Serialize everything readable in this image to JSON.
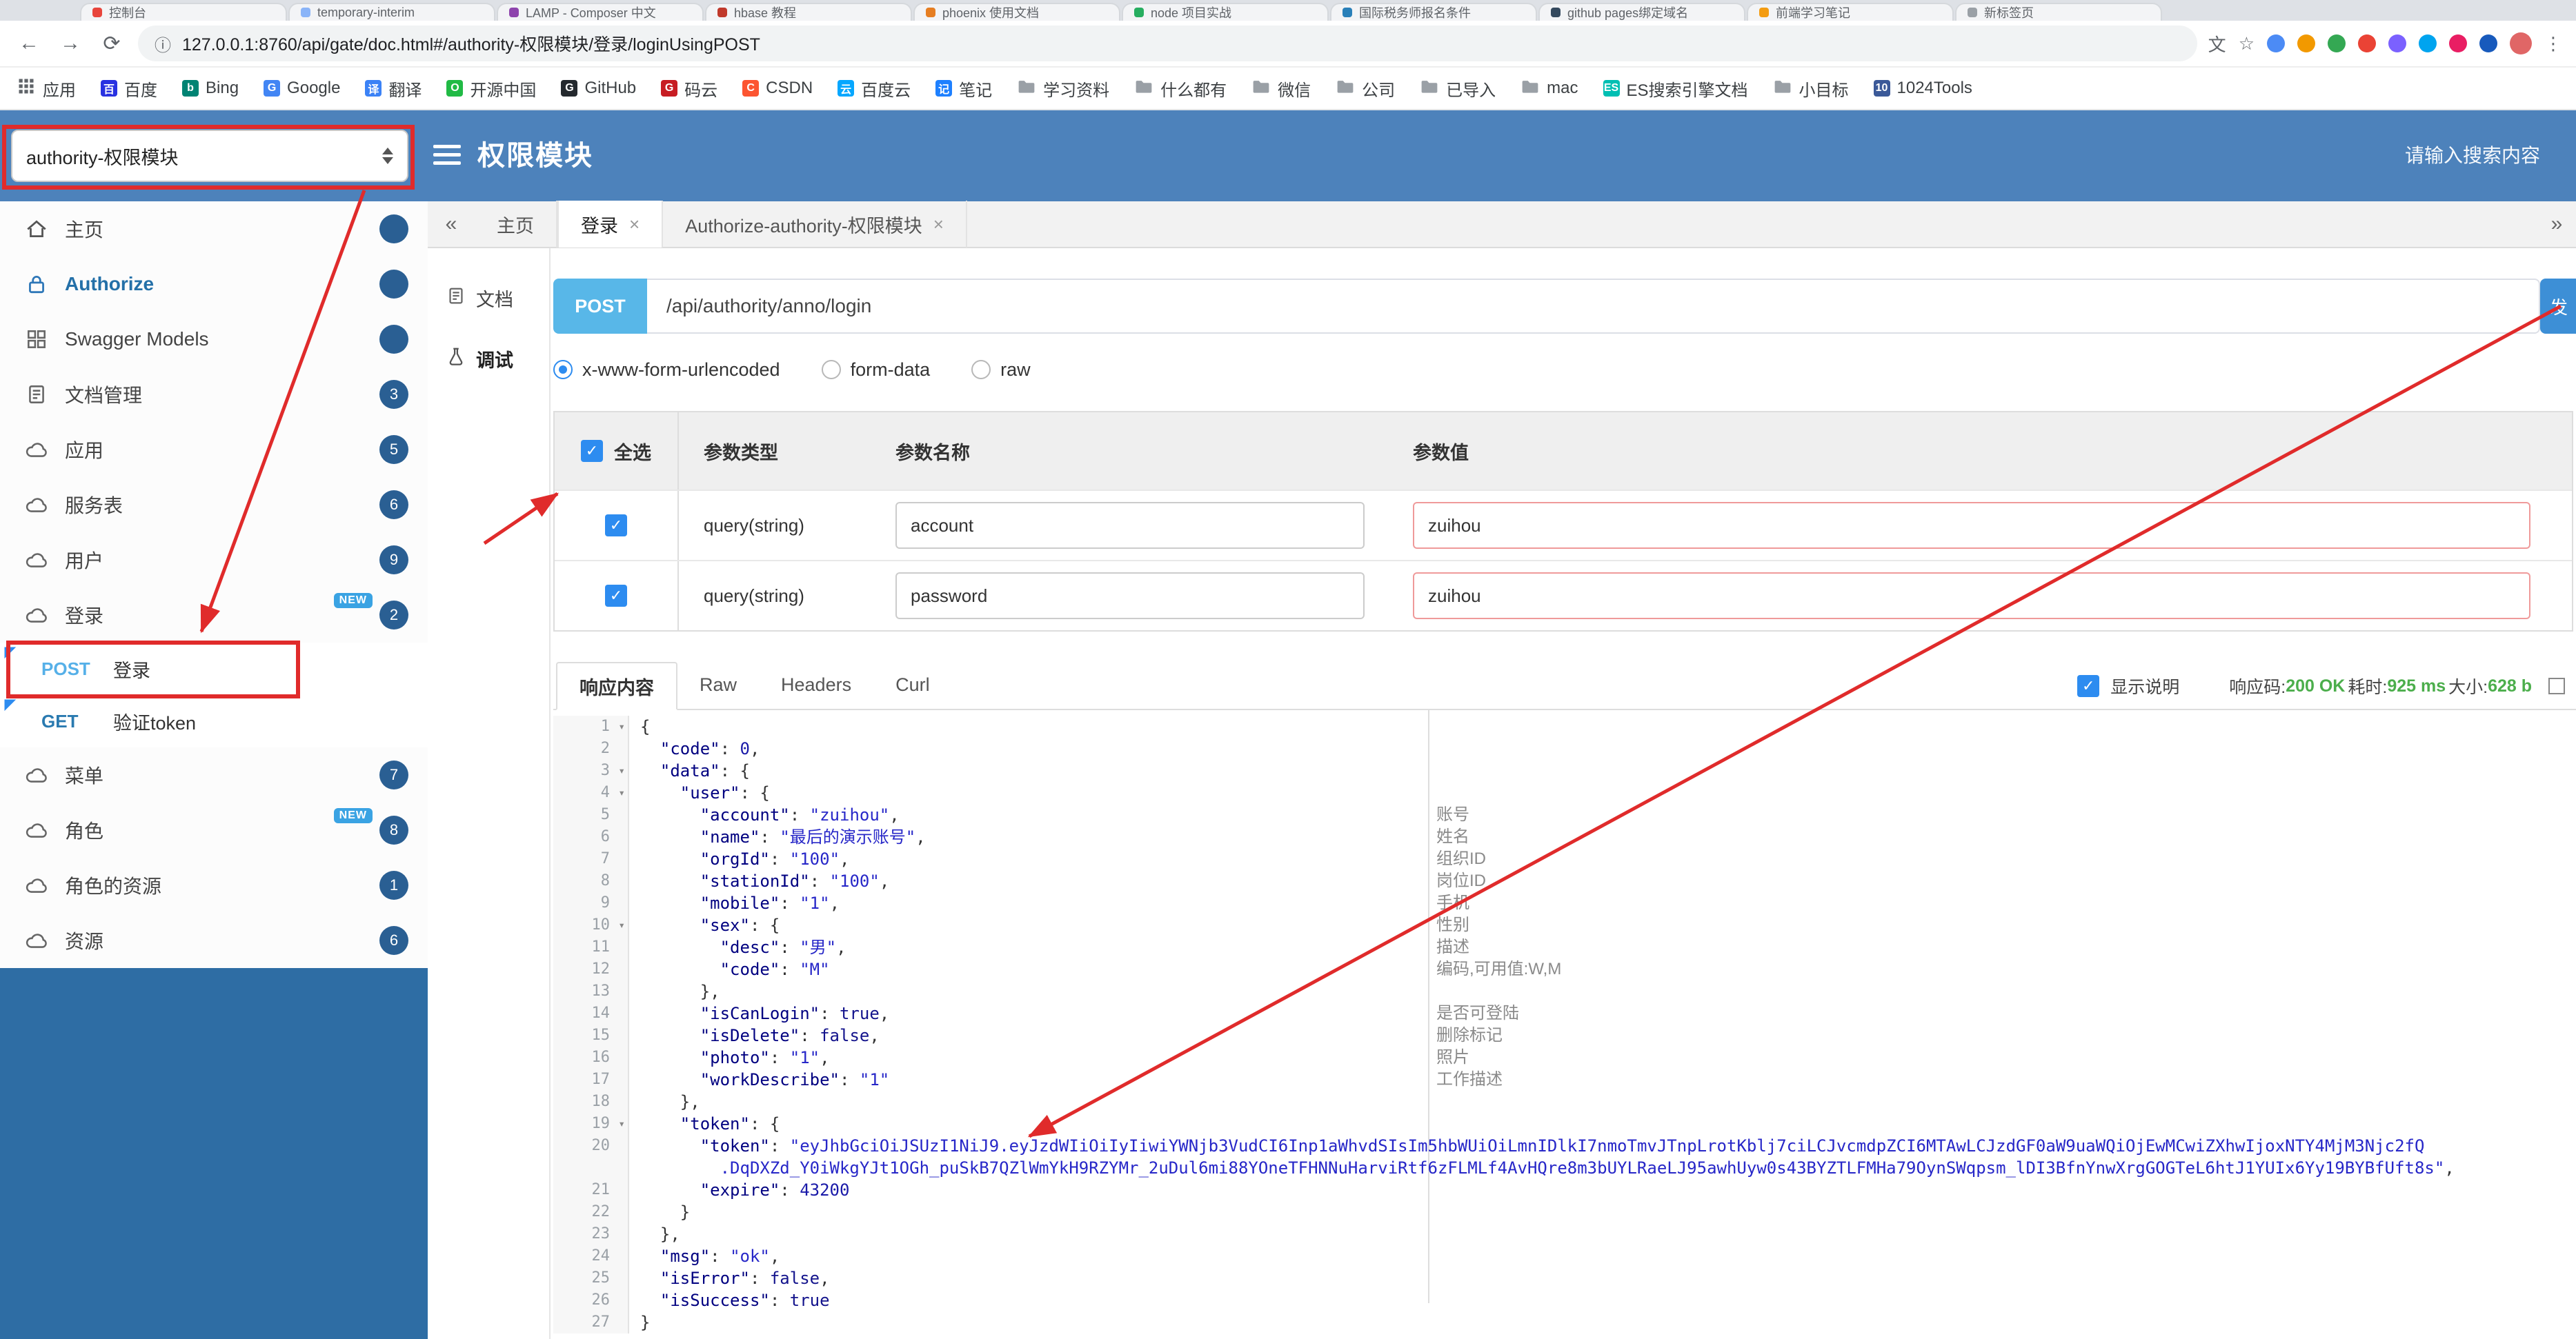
{
  "browser": {
    "window_lights": [
      "#ff5f57",
      "#febc2e",
      "#28c840"
    ],
    "tabs": [
      {
        "title": "控制台",
        "color": "#e8453c"
      },
      {
        "title": "temporary-interim",
        "color": "#8ab4f8"
      },
      {
        "title": "LAMP - Composer 中文",
        "color": "#8e44ad"
      },
      {
        "title": "hbase 教程",
        "color": "#c0392b"
      },
      {
        "title": "phoenix 使用文档",
        "color": "#e67e22"
      },
      {
        "title": "node 项目实战",
        "color": "#27ae60"
      },
      {
        "title": "国际税务师报名条件",
        "color": "#2980b9"
      },
      {
        "title": "github pages绑定域名",
        "color": "#34495e"
      },
      {
        "title": "前端学习笔记",
        "color": "#f39c12"
      },
      {
        "title": "新标签页",
        "color": "#9aa0a6"
      }
    ],
    "icons": {
      "back": "←",
      "forward": "→",
      "reload": "⟳",
      "info": "ⓘ",
      "star": "☆",
      "kebab": "⋮",
      "translate": "文"
    },
    "url": "127.0.0.1:8760/api/gate/doc.html#/authority-权限模块/登录/loginUsingPOST",
    "extensions": [
      "#4c8bf5",
      "#f29900",
      "#34a853",
      "#ea4335",
      "#7b61ff",
      "#00a4ef",
      "#e91e63",
      "#185abc"
    ],
    "bookmarks": [
      {
        "label": "应用",
        "icon": "apps"
      },
      {
        "label": "百度",
        "icon": "fav",
        "letter": "百",
        "color": "#2932e1"
      },
      {
        "label": "Bing",
        "icon": "fav",
        "letter": "b",
        "color": "#008373"
      },
      {
        "label": "Google",
        "icon": "fav",
        "letter": "G",
        "color": "#4285f4"
      },
      {
        "label": "翻译",
        "icon": "fav",
        "letter": "译",
        "color": "#3b82f6"
      },
      {
        "label": "开源中国",
        "icon": "fav",
        "letter": "O",
        "color": "#21ba45"
      },
      {
        "label": "GitHub",
        "icon": "fav",
        "letter": "G",
        "color": "#24292e"
      },
      {
        "label": "码云",
        "icon": "fav",
        "letter": "G",
        "color": "#c71d23"
      },
      {
        "label": "CSDN",
        "icon": "fav",
        "letter": "C",
        "color": "#fc5531"
      },
      {
        "label": "百度云",
        "icon": "fav",
        "letter": "云",
        "color": "#06a7ff"
      },
      {
        "label": "笔记",
        "icon": "fav",
        "letter": "记",
        "color": "#1e80ff"
      },
      {
        "label": "学习资料",
        "icon": "folder"
      },
      {
        "label": "什么都有",
        "icon": "folder"
      },
      {
        "label": "微信",
        "icon": "folder"
      },
      {
        "label": "公司",
        "icon": "folder"
      },
      {
        "label": "已导入",
        "icon": "folder"
      },
      {
        "label": "mac",
        "icon": "folder"
      },
      {
        "label": "ES搜索引擎文档",
        "icon": "fav",
        "letter": "ES",
        "color": "#00bfb3"
      },
      {
        "label": "小目标",
        "icon": "folder"
      },
      {
        "label": "1024Tools",
        "icon": "fav",
        "letter": "10",
        "color": "#3b5998"
      }
    ]
  },
  "header": {
    "module_select": {
      "value": "authority-权限模块"
    },
    "title": "权限模块",
    "search_placeholder": "请输入搜索内容"
  },
  "sidebar": {
    "new_badge_label": "NEW",
    "items": [
      {
        "icon": "home",
        "label": "主页"
      },
      {
        "icon": "lock",
        "label": "Authorize",
        "accent": true
      },
      {
        "icon": "grid",
        "label": "Swagger Models"
      },
      {
        "icon": "doc",
        "label": "文档管理",
        "badge": "3"
      },
      {
        "icon": "cloud",
        "label": "应用",
        "badge": "5"
      },
      {
        "icon": "cloud",
        "label": "服务表",
        "badge": "6"
      },
      {
        "icon": "cloud",
        "label": "用户",
        "badge": "9"
      },
      {
        "icon": "cloud",
        "label": "登录",
        "badge": "2",
        "is_new": true
      },
      {
        "method": "POST",
        "label": "登录"
      },
      {
        "method": "GET",
        "label": "验证token"
      },
      {
        "icon": "cloud",
        "label": "菜单",
        "badge": "7"
      },
      {
        "icon": "cloud",
        "label": "角色",
        "badge": "8",
        "is_new": true
      },
      {
        "icon": "cloud",
        "label": "角色的资源",
        "badge": "1"
      },
      {
        "icon": "cloud",
        "label": "资源",
        "badge": "6"
      }
    ]
  },
  "doc_tabs": {
    "left_chevron": "«",
    "right_chevron": "»",
    "close_glyph": "×",
    "tabs": [
      {
        "label": "主页",
        "closable": false,
        "active": false
      },
      {
        "label": "登录",
        "closable": true,
        "active": true
      },
      {
        "label": "Authorize-authority-权限模块",
        "closable": true,
        "active": false
      }
    ]
  },
  "side_mini": {
    "items": [
      {
        "label": "文档",
        "icon": "doc",
        "active": false
      },
      {
        "label": "调试",
        "icon": "debug",
        "active": true
      }
    ]
  },
  "request": {
    "method": "POST",
    "url": "/api/authority/anno/login",
    "send_label": "发"
  },
  "body_type": [
    {
      "label": "x-www-form-urlencoded",
      "selected": true
    },
    {
      "label": "form-data",
      "selected": false
    },
    {
      "label": "raw",
      "selected": false
    }
  ],
  "params": {
    "headers": {
      "select_all": "全选",
      "type": "参数类型",
      "name": "参数名称",
      "value": "参数值"
    },
    "rows": [
      {
        "checked": true,
        "type": "query(string)",
        "name": "account",
        "value": "zuihou"
      },
      {
        "checked": true,
        "type": "query(string)",
        "name": "password",
        "value": "zuihou"
      }
    ]
  },
  "response": {
    "tabs": [
      {
        "label": "响应内容",
        "active": true
      },
      {
        "label": "Raw",
        "active": false
      },
      {
        "label": "Headers",
        "active": false
      },
      {
        "label": "Curl",
        "active": false
      }
    ],
    "show_desc_label": "显示说明",
    "show_desc_checked": true,
    "meta": [
      {
        "label": "响应码:",
        "value": "200 OK"
      },
      {
        "label": "耗时:",
        "value": "925 ms"
      },
      {
        "label": "大小:",
        "value": "628 b"
      }
    ]
  },
  "code": {
    "fold_caret": "▾",
    "lines": [
      {
        "num": 1,
        "fold": true,
        "segs": [
          [
            "p",
            "{"
          ]
        ]
      },
      {
        "num": 2,
        "segs": [
          [
            "p",
            "  "
          ],
          [
            "k",
            "\"code\""
          ],
          [
            "p",
            ": "
          ],
          [
            "n",
            "0"
          ],
          [
            "p",
            ","
          ]
        ]
      },
      {
        "num": 3,
        "fold": true,
        "segs": [
          [
            "p",
            "  "
          ],
          [
            "k",
            "\"data\""
          ],
          [
            "p",
            ": {"
          ]
        ]
      },
      {
        "num": 4,
        "fold": true,
        "segs": [
          [
            "p",
            "    "
          ],
          [
            "k",
            "\"user\""
          ],
          [
            "p",
            ": {"
          ]
        ]
      },
      {
        "num": 5,
        "note": "账号",
        "segs": [
          [
            "p",
            "      "
          ],
          [
            "k",
            "\"account\""
          ],
          [
            "p",
            ": "
          ],
          [
            "s",
            "\"zuihou\""
          ],
          [
            "p",
            ","
          ]
        ]
      },
      {
        "num": 6,
        "note": "姓名",
        "segs": [
          [
            "p",
            "      "
          ],
          [
            "k",
            "\"name\""
          ],
          [
            "p",
            ": "
          ],
          [
            "s",
            "\"最后的演示账号\""
          ],
          [
            "p",
            ","
          ]
        ]
      },
      {
        "num": 7,
        "note": "组织ID",
        "segs": [
          [
            "p",
            "      "
          ],
          [
            "k",
            "\"orgId\""
          ],
          [
            "p",
            ": "
          ],
          [
            "s",
            "\"100\""
          ],
          [
            "p",
            ","
          ]
        ]
      },
      {
        "num": 8,
        "note": "岗位ID",
        "segs": [
          [
            "p",
            "      "
          ],
          [
            "k",
            "\"stationId\""
          ],
          [
            "p",
            ": "
          ],
          [
            "s",
            "\"100\""
          ],
          [
            "p",
            ","
          ]
        ]
      },
      {
        "num": 9,
        "note": "手机",
        "segs": [
          [
            "p",
            "      "
          ],
          [
            "k",
            "\"mobile\""
          ],
          [
            "p",
            ": "
          ],
          [
            "s",
            "\"1\""
          ],
          [
            "p",
            ","
          ]
        ]
      },
      {
        "num": 10,
        "fold": true,
        "note": "性别",
        "segs": [
          [
            "p",
            "      "
          ],
          [
            "k",
            "\"sex\""
          ],
          [
            "p",
            ": {"
          ]
        ]
      },
      {
        "num": 11,
        "note": "描述",
        "segs": [
          [
            "p",
            "        "
          ],
          [
            "k",
            "\"desc\""
          ],
          [
            "p",
            ": "
          ],
          [
            "s",
            "\"男\""
          ],
          [
            "p",
            ","
          ]
        ]
      },
      {
        "num": 12,
        "note": "编码,可用值:W,M",
        "segs": [
          [
            "p",
            "        "
          ],
          [
            "k",
            "\"code\""
          ],
          [
            "p",
            ": "
          ],
          [
            "s",
            "\"M\""
          ]
        ]
      },
      {
        "num": 13,
        "segs": [
          [
            "p",
            "      },"
          ]
        ]
      },
      {
        "num": 14,
        "note": "是否可登陆",
        "segs": [
          [
            "p",
            "      "
          ],
          [
            "k",
            "\"isCanLogin\""
          ],
          [
            "p",
            ": "
          ],
          [
            "b",
            "true"
          ],
          [
            "p",
            ","
          ]
        ]
      },
      {
        "num": 15,
        "note": "删除标记",
        "segs": [
          [
            "p",
            "      "
          ],
          [
            "k",
            "\"isDelete\""
          ],
          [
            "p",
            ": "
          ],
          [
            "b",
            "false"
          ],
          [
            "p",
            ","
          ]
        ]
      },
      {
        "num": 16,
        "note": "照片",
        "segs": [
          [
            "p",
            "      "
          ],
          [
            "k",
            "\"photo\""
          ],
          [
            "p",
            ": "
          ],
          [
            "s",
            "\"1\""
          ],
          [
            "p",
            ","
          ]
        ]
      },
      {
        "num": 17,
        "note": "工作描述",
        "segs": [
          [
            "p",
            "      "
          ],
          [
            "k",
            "\"workDescribe\""
          ],
          [
            "p",
            ": "
          ],
          [
            "s",
            "\"1\""
          ]
        ]
      },
      {
        "num": 18,
        "segs": [
          [
            "p",
            "    },"
          ]
        ]
      },
      {
        "num": 19,
        "fold": true,
        "segs": [
          [
            "p",
            "    "
          ],
          [
            "k",
            "\"token\""
          ],
          [
            "p",
            ": {"
          ]
        ]
      },
      {
        "num": 20,
        "segs": [
          [
            "p",
            "      "
          ],
          [
            "k",
            "\"token\""
          ],
          [
            "p",
            ": "
          ],
          [
            "s",
            "\"eyJhbGciOiJSUzI1NiJ9.eyJzdWIiOiIyIiwiYWNjb3VudCI6Inp1aWhvdSIsIm5hbWUiOiLmnIDlkI7nmoTmvJTnpLrotKblj7ciLCJvcmdpZCI6MTAwLCJzdGF0aW9uaWQiOjEwMCwiZXhwIjoxNTY4MjM3Njc2fQ"
          ]
        ]
      },
      {
        "num": null,
        "segs": [
          [
            "s",
            "        .DqDXZd_Y0iWkgYJt1OGh_puSkB7QZlWmYkH9RZYMr_2uDul6mi88YOneTFHNNuHarviRtf6zFLMLf4AvHQre8m3bUYLRaeLJ95awhUyw0s43BYZTLFMHa79OynSWqpsm_lDI3BfnYnwXrgGOGTeL6htJ1YUIx6Yy19BYBfUft8s\""
          ],
          [
            "p",
            ","
          ]
        ]
      },
      {
        "num": 21,
        "segs": [
          [
            "p",
            "      "
          ],
          [
            "k",
            "\"expire\""
          ],
          [
            "p",
            ": "
          ],
          [
            "n",
            "43200"
          ]
        ]
      },
      {
        "num": 22,
        "segs": [
          [
            "p",
            "    }"
          ]
        ]
      },
      {
        "num": 23,
        "segs": [
          [
            "p",
            "  },"
          ]
        ]
      },
      {
        "num": 24,
        "segs": [
          [
            "p",
            "  "
          ],
          [
            "k",
            "\"msg\""
          ],
          [
            "p",
            ": "
          ],
          [
            "s",
            "\"ok\""
          ],
          [
            "p",
            ","
          ]
        ]
      },
      {
        "num": 25,
        "segs": [
          [
            "p",
            "  "
          ],
          [
            "k",
            "\"isError\""
          ],
          [
            "p",
            ": "
          ],
          [
            "b",
            "false"
          ],
          [
            "p",
            ","
          ]
        ]
      },
      {
        "num": 26,
        "segs": [
          [
            "p",
            "  "
          ],
          [
            "k",
            "\"isSuccess\""
          ],
          [
            "p",
            ": "
          ],
          [
            "b",
            "true"
          ]
        ]
      },
      {
        "num": 27,
        "segs": [
          [
            "p",
            "}"
          ]
        ]
      }
    ]
  }
}
